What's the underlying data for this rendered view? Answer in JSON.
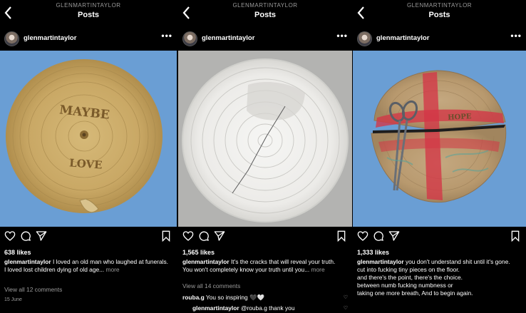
{
  "panels": [
    {
      "account_header": "GLENMARTINTAYLOR",
      "header_title": "Posts",
      "username": "glenmartintaylor",
      "more": "•••",
      "likes": "638 likes",
      "caption": {
        "username": "glenmartintaylor",
        "text1": " I loved an old man who laughed at funerals.",
        "text2": "I loved lost children dying of old age...",
        "more": " more"
      },
      "view_comments": "View all 12 comments",
      "date": "15 June",
      "plate_text": [
        "MAYBE",
        "LOVE"
      ]
    },
    {
      "account_header": "GLENMARTINTAYLOR",
      "header_title": "Posts",
      "username": "glenmartintaylor",
      "more": "•••",
      "likes": "1,565 likes",
      "caption": {
        "username": "glenmartintaylor",
        "text1": " It's the cracks that will reveal your truth.",
        "text2": "You won't completely know your truth until you...",
        "more": " more"
      },
      "view_comments": "View all 14 comments",
      "comment1": {
        "username": "rouba.g",
        "text": " You so inspiring 🖤🤍"
      },
      "comment2": {
        "username": "glenmartintaylor",
        "text": " @rouba.g thank you"
      }
    },
    {
      "account_header": "GLENMARTINTAYLOR",
      "header_title": "Posts",
      "username": "glenmartintaylor",
      "more": "•••",
      "likes": "1,333 likes",
      "caption": {
        "username": "glenmartintaylor",
        "lines": [
          " you don't understand shit until it's gone.",
          "cut into fucking tiny pieces on the floor.",
          "and there's the point, there's the choice.",
          "between numb fucking numbness or",
          "taking one more breath, And to begin again."
        ]
      },
      "plate_text": [
        "HOPE"
      ]
    }
  ],
  "colors": {
    "background": "#000000",
    "muted_text": "#9a9a9a",
    "photo_blue": "#6a9ed4",
    "photo_grey": "#b3b3b1"
  }
}
